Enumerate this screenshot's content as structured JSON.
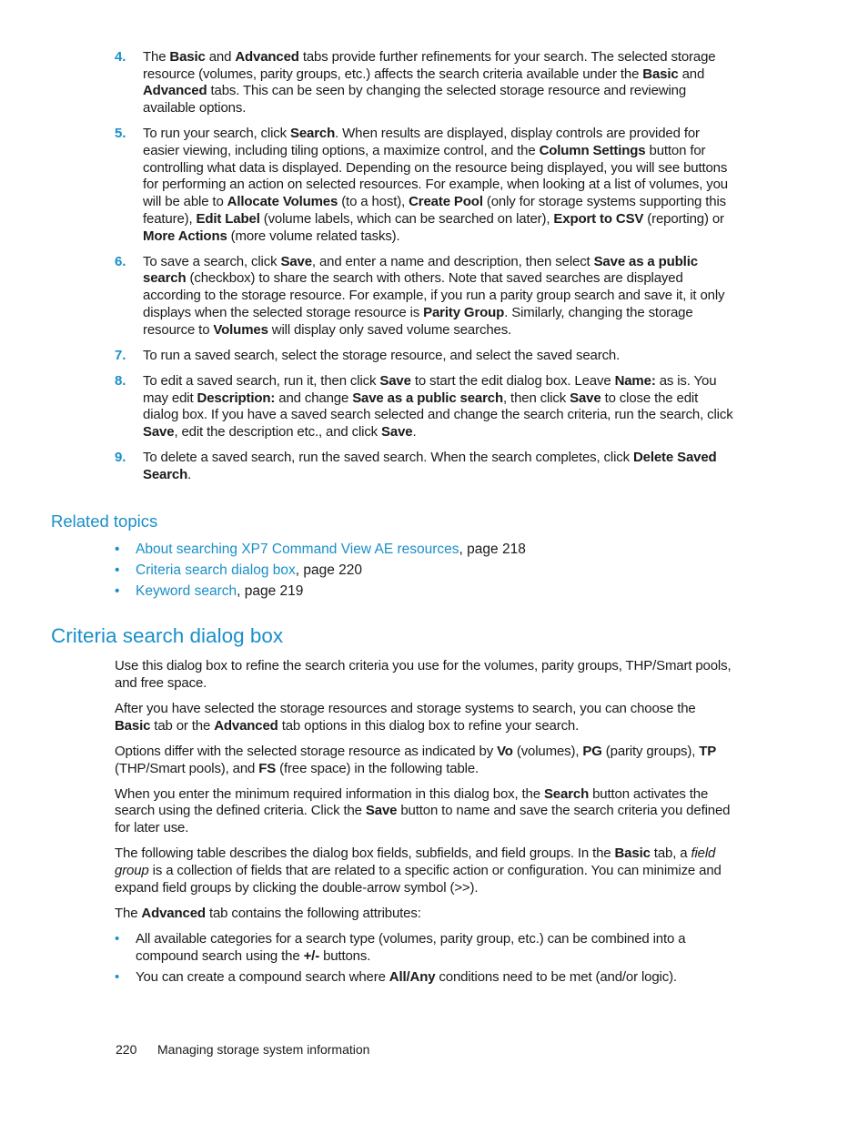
{
  "steps": [
    {
      "number": "4.",
      "segments": [
        {
          "t": "The "
        },
        {
          "t": "Basic",
          "b": true
        },
        {
          "t": " and "
        },
        {
          "t": "Advanced",
          "b": true
        },
        {
          "t": " tabs provide further refinements for your search. The selected storage resource (volumes, parity groups, etc.) affects the search criteria available under the "
        },
        {
          "t": "Basic",
          "b": true
        },
        {
          "t": " and "
        },
        {
          "t": "Advanced",
          "b": true
        },
        {
          "t": " tabs. This can be seen by changing the selected storage resource and reviewing available options."
        }
      ]
    },
    {
      "number": "5.",
      "segments": [
        {
          "t": "To run your search, click "
        },
        {
          "t": "Search",
          "b": true
        },
        {
          "t": ". When results are displayed, display controls are provided for easier viewing, including tiling options, a maximize control, and the "
        },
        {
          "t": "Column Settings",
          "b": true
        },
        {
          "t": " button for controlling what data is displayed. Depending on the resource being displayed, you will see buttons for performing an action on selected resources. For example, when looking at a list of volumes, you will be able to "
        },
        {
          "t": "Allocate Volumes",
          "b": true
        },
        {
          "t": " (to a host), "
        },
        {
          "t": "Create Pool",
          "b": true
        },
        {
          "t": " (only for storage systems supporting this feature), "
        },
        {
          "t": "Edit Label",
          "b": true
        },
        {
          "t": " (volume labels, which can be searched on later), "
        },
        {
          "t": "Export to CSV",
          "b": true
        },
        {
          "t": " (reporting) or "
        },
        {
          "t": "More Actions",
          "b": true
        },
        {
          "t": " (more volume related tasks)."
        }
      ]
    },
    {
      "number": "6.",
      "segments": [
        {
          "t": "To save a search, click "
        },
        {
          "t": "Save",
          "b": true
        },
        {
          "t": ", and enter a name and description, then select "
        },
        {
          "t": "Save as a public search",
          "b": true
        },
        {
          "t": " (checkbox) to share the search with others. Note that saved searches are displayed according to the storage resource. For example, if you run a parity group search and save it, it only displays when the selected storage resource is "
        },
        {
          "t": "Parity Group",
          "b": true
        },
        {
          "t": ". Similarly, changing the storage resource to "
        },
        {
          "t": "Volumes",
          "b": true
        },
        {
          "t": " will display only saved volume searches."
        }
      ]
    },
    {
      "number": "7.",
      "segments": [
        {
          "t": "To run a saved search, select the storage resource, and select the saved search."
        }
      ]
    },
    {
      "number": "8.",
      "segments": [
        {
          "t": "To edit a saved search, run it, then click "
        },
        {
          "t": "Save",
          "b": true
        },
        {
          "t": " to start the edit dialog box. Leave "
        },
        {
          "t": "Name:",
          "b": true
        },
        {
          "t": " as is. You may edit "
        },
        {
          "t": "Description:",
          "b": true
        },
        {
          "t": " and change "
        },
        {
          "t": "Save as a public search",
          "b": true
        },
        {
          "t": ", then click "
        },
        {
          "t": "Save",
          "b": true
        },
        {
          "t": " to close the edit dialog box. If you have a saved search selected and change the search criteria, run the search, click "
        },
        {
          "t": "Save",
          "b": true
        },
        {
          "t": ", edit the description etc., and click "
        },
        {
          "t": "Save",
          "b": true
        },
        {
          "t": "."
        }
      ]
    },
    {
      "number": "9.",
      "segments": [
        {
          "t": "To delete a saved search, run the saved search. When the search completes, click "
        },
        {
          "t": "Delete Saved Search",
          "b": true
        },
        {
          "t": "."
        }
      ]
    }
  ],
  "related": {
    "heading": "Related topics",
    "bullet": "•",
    "items": [
      {
        "link": "About searching XP7 Command View AE resources",
        "suffix": ", page 218"
      },
      {
        "link": "Criteria search dialog box",
        "suffix": ", page 220"
      },
      {
        "link": "Keyword search",
        "suffix": ", page 219"
      }
    ]
  },
  "section": {
    "heading": "Criteria search dialog box",
    "paragraphs": [
      [
        {
          "t": "Use this dialog box to refine the search criteria you use for the volumes, parity groups, THP/Smart pools, and free space."
        }
      ],
      [
        {
          "t": "After you have selected the storage resources and storage systems to search, you can choose the "
        },
        {
          "t": "Basic",
          "b": true
        },
        {
          "t": " tab or the "
        },
        {
          "t": "Advanced",
          "b": true
        },
        {
          "t": " tab options in this dialog box to refine your search."
        }
      ],
      [
        {
          "t": "Options differ with the selected storage resource as indicated by "
        },
        {
          "t": "Vo",
          "b": true
        },
        {
          "t": " (volumes), "
        },
        {
          "t": "PG",
          "b": true
        },
        {
          "t": " (parity groups), "
        },
        {
          "t": "TP",
          "b": true
        },
        {
          "t": " (THP/Smart pools), and "
        },
        {
          "t": "FS",
          "b": true
        },
        {
          "t": " (free space) in the following table."
        }
      ],
      [
        {
          "t": "When you enter the minimum required information in this dialog box, the  "
        },
        {
          "t": "Search",
          "b": true
        },
        {
          "t": " button activates the search using the defined criteria. Click the "
        },
        {
          "t": "Save",
          "b": true
        },
        {
          "t": " button to name and save the search criteria you defined for later use."
        }
      ],
      [
        {
          "t": "The following table describes the dialog box fields, subfields, and field groups. In the "
        },
        {
          "t": "Basic",
          "b": true
        },
        {
          "t": " tab, a "
        },
        {
          "t": "field group",
          "i": true
        },
        {
          "t": " is a collection of fields that are related to a specific action or configuration. You can minimize and expand field groups by clicking the double-arrow symbol (>>)."
        }
      ],
      [
        {
          "t": "The "
        },
        {
          "t": "Advanced",
          "b": true
        },
        {
          "t": " tab contains the following attributes:"
        }
      ]
    ],
    "attributes": [
      [
        {
          "t": "All available categories for a search type (volumes, parity group, etc.) can be combined into a compound search using the "
        },
        {
          "t": "+/-",
          "b": true
        },
        {
          "t": " buttons."
        }
      ],
      [
        {
          "t": "You can create a compound search where "
        },
        {
          "t": "All/Any",
          "b": true
        },
        {
          "t": " conditions need to be met (and/or logic)."
        }
      ]
    ]
  },
  "footer": {
    "page_number": "220",
    "chapter": "Managing storage system information"
  }
}
